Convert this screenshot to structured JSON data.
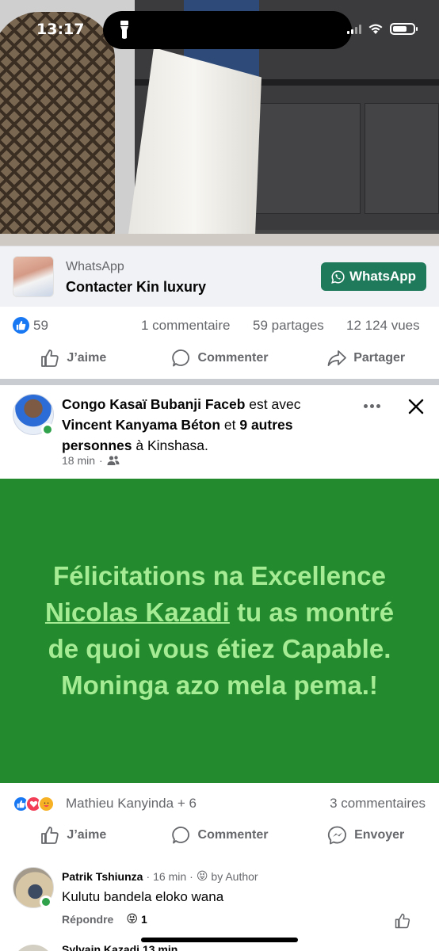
{
  "status_bar": {
    "time": "13:17"
  },
  "ad": {
    "source": "WhatsApp",
    "title": "Contacter Kin luxury",
    "button_label": "WhatsApp",
    "button_color": "#1e7a5a"
  },
  "post1_stats": {
    "likes": "59",
    "comments": "1 commentaire",
    "shares": "59 partages",
    "views": "12 124 vues"
  },
  "actions1": {
    "like": "J’aime",
    "comment": "Commenter",
    "share": "Partager"
  },
  "post2": {
    "author": "Congo Kasaï Bubanji Faceb",
    "with_text": " est avec",
    "tagged": "Vincent Kanyama Béton",
    "and_text": " et ",
    "others": "9 autres personnes",
    "location_prefix": " à ",
    "location": "Kinshasa",
    "location_suffix": ".",
    "time": "18 min",
    "audience_icon": "friends-icon",
    "text_part1": "Félicitations na Excellence ",
    "text_mention": "Nicolas Kazadi",
    "text_part2": " tu as montré de quoi vous étiez Capable. Moninga azo mela pema.!",
    "background_color": "#248a2e",
    "text_color": "#a6ec94"
  },
  "post2_stats": {
    "reactors": "Mathieu Kanyinda + 6",
    "comments": "3 commentaires"
  },
  "actions2": {
    "like": "J’aime",
    "comment": "Commenter",
    "send": "Envoyer"
  },
  "comment": {
    "author": "Patrik Tshiunza",
    "separator1": "·",
    "time": "16 min",
    "separator2": "·",
    "badge": "by Author",
    "text": "Kulutu bandela eloko wana",
    "reply_label": "Répondre",
    "reaction_count": "1"
  },
  "next_comment": {
    "author": "Sylvain Kazadi",
    "time": "13 min"
  }
}
